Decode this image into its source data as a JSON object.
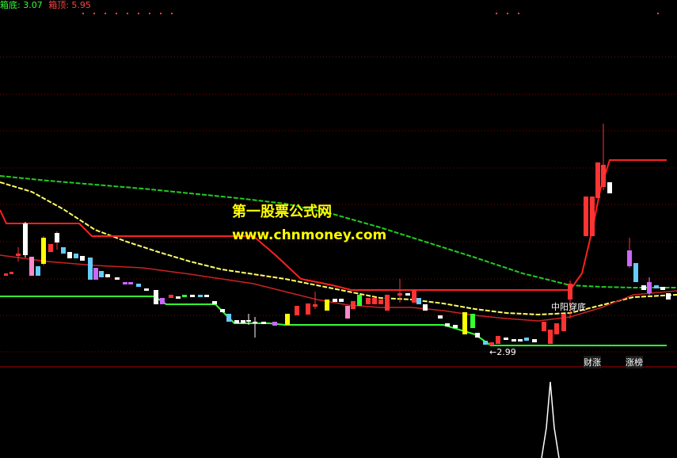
{
  "header": {
    "box_bottom_label": "箱底: 3.07",
    "box_top_label": "箱顶: 5.95"
  },
  "watermark": {
    "title": "第一股票公式网",
    "url": "www.chnmoney.com"
  },
  "annotations": {
    "mid_yang_label": "中阳穿底",
    "low_marker": "←2.99",
    "cai_zhang_label": "财涨",
    "lian_bang_label": "涨榜"
  },
  "colors": {
    "background": "#000000",
    "grid_dotted": "#8b0000",
    "box_line": "#ff2020",
    "support_line": "#33ff33",
    "green_ma": "#22cc22",
    "yellow_ma": "#ffff66",
    "red_ma": "#cc2222",
    "header_green": "#33ff33",
    "header_red": "#ff4444",
    "watermark": "#ffff00"
  }
}
